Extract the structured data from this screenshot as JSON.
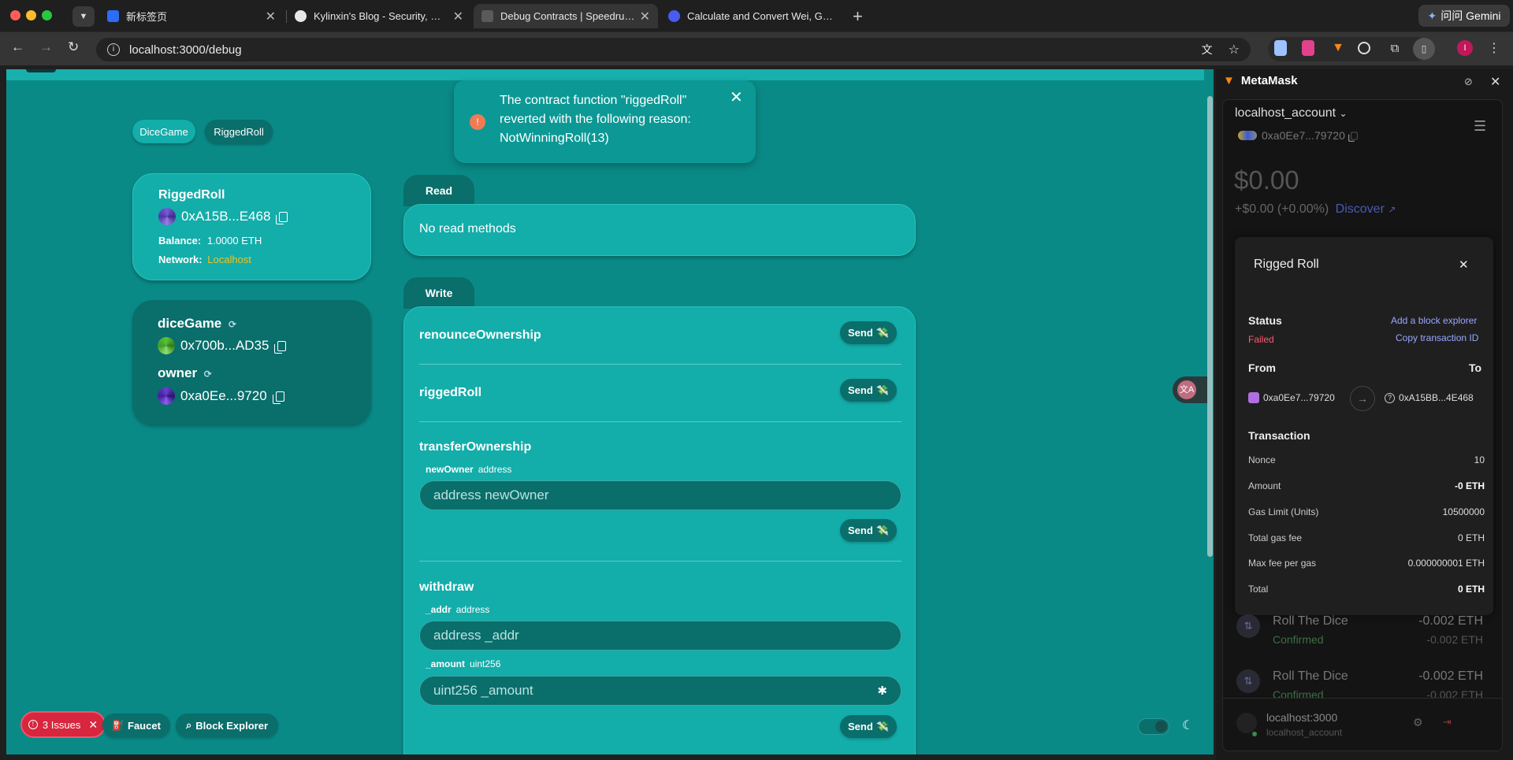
{
  "browser": {
    "tabs": [
      {
        "title": "新标签页",
        "fav": "#2c6cf6"
      },
      {
        "title": "Kylinxin's Blog - Security, Web",
        "fav": "#e8e8e8"
      },
      {
        "title": "Debug Contracts | Speedrun Eth",
        "fav": "#5a5a5a"
      },
      {
        "title": "Calculate and Convert Wei, Gwei",
        "fav": "#4a5bf0"
      }
    ],
    "url": "localhost:3000/debug",
    "gemini_label": "问问 Gemini",
    "profile_initial": "I"
  },
  "contract_tabs": [
    "DiceGame",
    "RiggedRoll"
  ],
  "contract_card": {
    "name": "RiggedRoll",
    "address": "0xA15B...E468",
    "balance_label": "Balance:",
    "balance": "1.0000",
    "balance_unit": "ETH",
    "network_label": "Network:",
    "network": "Localhost"
  },
  "state_card": {
    "vars": [
      {
        "name": "diceGame",
        "address": "0x700b...AD35"
      },
      {
        "name": "owner",
        "address": "0xa0Ee...9720"
      }
    ]
  },
  "read": {
    "tab": "Read",
    "empty": "No read methods"
  },
  "write": {
    "tab": "Write",
    "send_label": "Send",
    "functions": [
      {
        "name": "renounceOwnership"
      },
      {
        "name": "riggedRoll"
      },
      {
        "name": "transferOwnership",
        "params": [
          {
            "name": "newOwner",
            "type": "address",
            "placeholder": "address newOwner"
          }
        ]
      },
      {
        "name": "withdraw",
        "params": [
          {
            "name": "_addr",
            "type": "address",
            "placeholder": "address _addr"
          },
          {
            "name": "_amount",
            "type": "uint256",
            "placeholder": "uint256 _amount"
          }
        ]
      }
    ]
  },
  "toast": {
    "message": "The contract function \"riggedRoll\" reverted with the following reason: NotWinningRoll(13)"
  },
  "footer": {
    "issues": "3 Issues",
    "faucet": "Faucet",
    "block_explorer": "Block Explorer"
  },
  "metamask": {
    "title": "MetaMask",
    "account": "localhost_account",
    "address": "0xa0Ee7...79720",
    "balance": "$0.00",
    "change": "+$0.00 (+0.00%)",
    "discover": "Discover",
    "modal": {
      "title": "Rigged Roll",
      "status_label": "Status",
      "status": "Failed",
      "add_explorer": "Add a block explorer",
      "copy_tx": "Copy transaction ID",
      "from_label": "From",
      "to_label": "To",
      "from": "0xa0Ee7...79720",
      "to": "0xA15BB...4E468",
      "transaction_label": "Transaction",
      "rows": [
        {
          "label": "Nonce",
          "value": "10",
          "bold": false
        },
        {
          "label": "Amount",
          "value": "-0 ETH",
          "bold": true
        },
        {
          "label": "Gas Limit (Units)",
          "value": "10500000",
          "bold": false
        },
        {
          "label": "Total gas fee",
          "value": "0 ETH",
          "bold": false
        },
        {
          "label": "Max fee per gas",
          "value": "0.000000001 ETH",
          "bold": false
        },
        {
          "label": "Total",
          "value": "0 ETH",
          "bold": true
        }
      ]
    },
    "activity": [
      {
        "title": "Roll The Dice",
        "status": "Confirmed",
        "amount": "-0.002 ETH",
        "sub": "-0.002 ETH"
      },
      {
        "title": "Roll The Dice",
        "status": "Confirmed",
        "amount": "-0.002 ETH",
        "sub": "-0.002 ETH"
      }
    ],
    "site": "localhost:3000",
    "site_account": "localhost_account"
  }
}
